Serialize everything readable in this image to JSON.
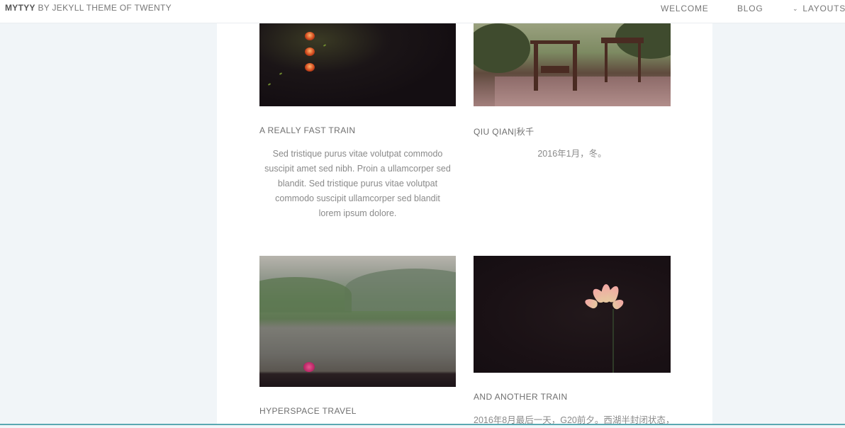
{
  "header": {
    "brand_bold": "MYTYY",
    "brand_rest": "BY JEKYLL THEME OF TWENTY",
    "nav": {
      "welcome": "WELCOME",
      "blog": "BLOG",
      "layouts": "LAYOUTS"
    }
  },
  "posts": [
    {
      "title": "A REALLY FAST TRAIN",
      "text_lines": [
        "Sed tristique purus vitae volutpat commodo",
        "suscipit amet sed nibh. Proin a ullamcorper sed",
        "blandit. Sed tristique purus vitae volutpat",
        "commodo suscipit ullamcorper sed blandit",
        "lorem ipsum dolore."
      ]
    },
    {
      "title": "QIU QIAN|秋千",
      "text_lines": [
        "2016年1月，冬。"
      ]
    },
    {
      "title": "HYPERSPACE TRAVEL",
      "text_lines": []
    },
    {
      "title": "AND ANOTHER TRAIN",
      "text_lines": [
        "2016年8月最后一天，G20前夕。西湖半封闭状态，"
      ]
    }
  ],
  "colors": {
    "page_bg": "#f1f5f8",
    "panel_bg": "#ffffff",
    "accent_line": "#5aa8b2"
  }
}
